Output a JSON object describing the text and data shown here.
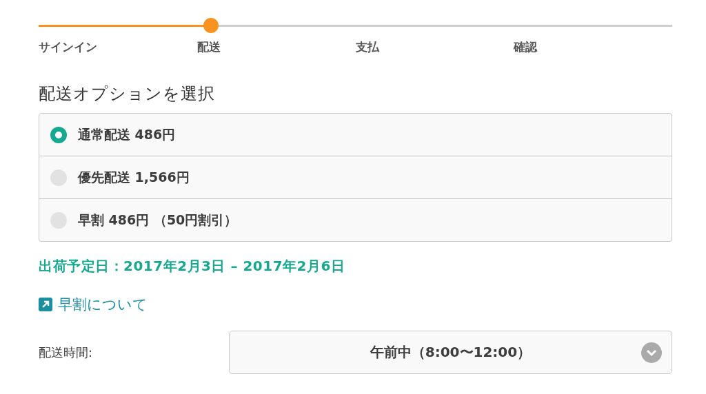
{
  "progress": {
    "level": 0.272
  },
  "steps": [
    {
      "label": "サインイン"
    },
    {
      "label": "配送"
    },
    {
      "label": "支払"
    },
    {
      "label": "確認"
    }
  ],
  "heading": "配送オプションを選択",
  "options": [
    {
      "label": "通常配送 486円",
      "selected": true
    },
    {
      "label": "優先配送 1,566円",
      "selected": false
    },
    {
      "label": "早割 486円 （50円割引）",
      "selected": false
    }
  ],
  "ship_date": "出荷予定日：2017年2月3日 – 2017年2月6日",
  "link": "早割について",
  "delivery_time": {
    "label": "配送時間:",
    "value": "午前中（8:00〜12:00）"
  }
}
